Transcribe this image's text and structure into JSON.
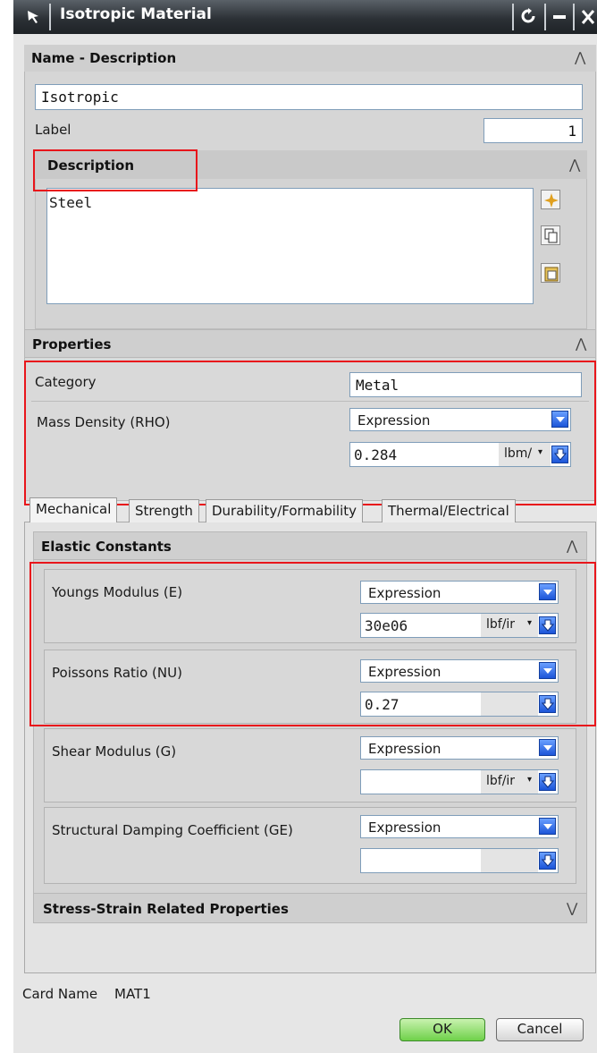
{
  "window": {
    "title": "Isotropic Material"
  },
  "name_section": {
    "header": "Name - Description",
    "name_value": "Isotropic",
    "label_text": "Label",
    "label_value": "1",
    "description": {
      "header": "Description",
      "text": "Steel"
    }
  },
  "properties": {
    "header": "Properties",
    "category_label": "Category",
    "category_value": "Metal",
    "mass_density": {
      "label": "Mass Density (RHO)",
      "mode": "Expression",
      "value": "0.284",
      "unit": "lbm/"
    }
  },
  "tabs": [
    "Mechanical",
    "Strength",
    "Durability/Formability",
    "Thermal/Electrical"
  ],
  "elastic": {
    "header": "Elastic Constants",
    "rows": [
      {
        "label": "Youngs Modulus (E)",
        "mode": "Expression",
        "value": "30e06",
        "unit": "lbf/ir"
      },
      {
        "label": "Poissons Ratio (NU)",
        "mode": "Expression",
        "value": "0.27",
        "unit": ""
      },
      {
        "label": "Shear Modulus (G)",
        "mode": "Expression",
        "value": "",
        "unit": "lbf/ir"
      },
      {
        "label": "Structural Damping Coefficient (GE)",
        "mode": "Expression",
        "value": "",
        "unit": ""
      }
    ]
  },
  "stress_strain": {
    "header": "Stress-Strain Related Properties"
  },
  "card": {
    "label": "Card Name",
    "value": "MAT1"
  },
  "buttons": {
    "ok": "OK",
    "cancel": "Cancel"
  }
}
